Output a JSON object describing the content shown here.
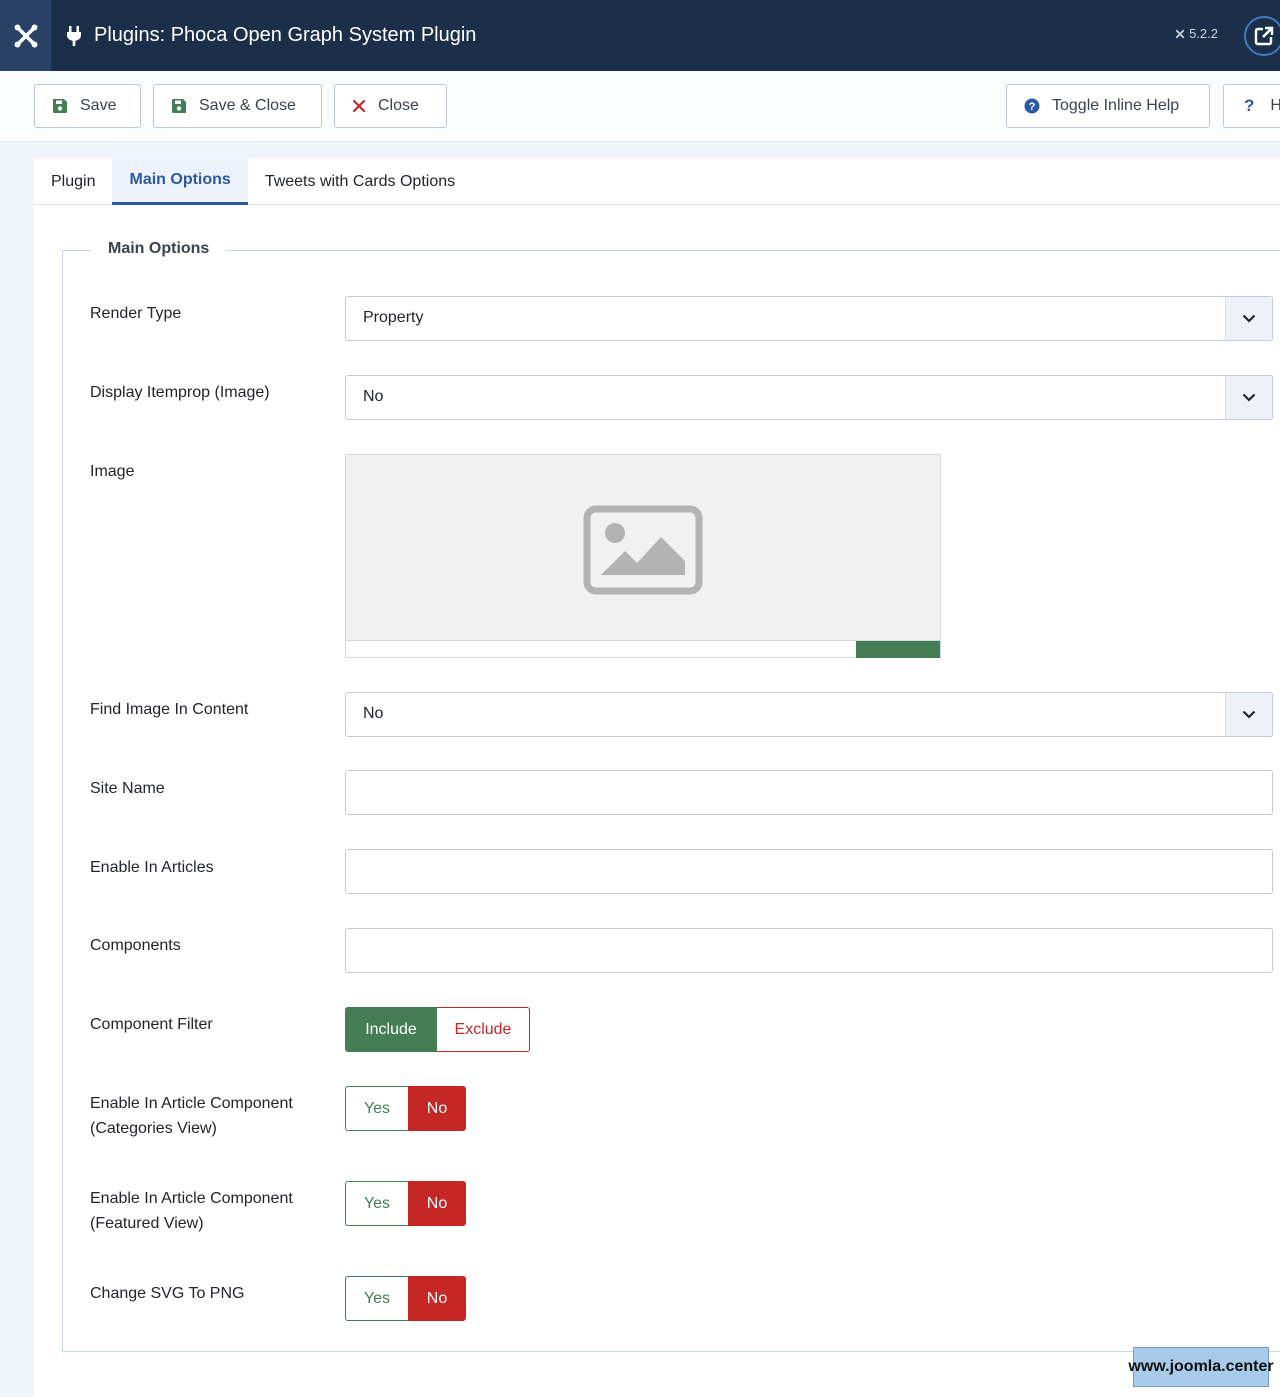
{
  "header": {
    "title": "Plugins: Phoca Open Graph System Plugin",
    "version": "5.2.2"
  },
  "toolbar": {
    "save_label": "Save",
    "save_close_label": "Save & Close",
    "close_label": "Close",
    "toggle_help_label": "Toggle Inline Help",
    "help_label": "H"
  },
  "tabs": [
    {
      "label": "Plugin"
    },
    {
      "label": "Main Options"
    },
    {
      "label": "Tweets with Cards Options"
    }
  ],
  "main": {
    "legend": "Main Options",
    "fields": {
      "render_type": {
        "label": "Render Type",
        "value": "Property"
      },
      "display_itemprop": {
        "label": "Display Itemprop (Image)",
        "value": "No"
      },
      "image": {
        "label": "Image"
      },
      "find_image": {
        "label": "Find Image In Content",
        "value": "No"
      },
      "site_name": {
        "label": "Site Name",
        "value": ""
      },
      "enable_articles": {
        "label": "Enable In Articles",
        "value": ""
      },
      "components": {
        "label": "Components",
        "value": ""
      },
      "component_filter": {
        "label": "Component Filter",
        "options": [
          "Include",
          "Exclude"
        ],
        "selected": "Include"
      },
      "cat_view": {
        "label_line1": "Enable In Article Component",
        "label_line2": "(Categories View)",
        "options": [
          "Yes",
          "No"
        ],
        "selected": "No"
      },
      "featured_view": {
        "label_line1": "Enable In Article Component",
        "label_line2": "(Featured View)",
        "options": [
          "Yes",
          "No"
        ],
        "selected": "No"
      },
      "svg_png": {
        "label": "Change SVG To PNG",
        "options": [
          "Yes",
          "No"
        ],
        "selected": "No"
      }
    }
  },
  "watermark": "www.joomla.center",
  "colors": {
    "header_bg": "#1c2f4a",
    "green": "#457d54",
    "red": "#c52727",
    "tab_active": "#2a5aa0"
  }
}
